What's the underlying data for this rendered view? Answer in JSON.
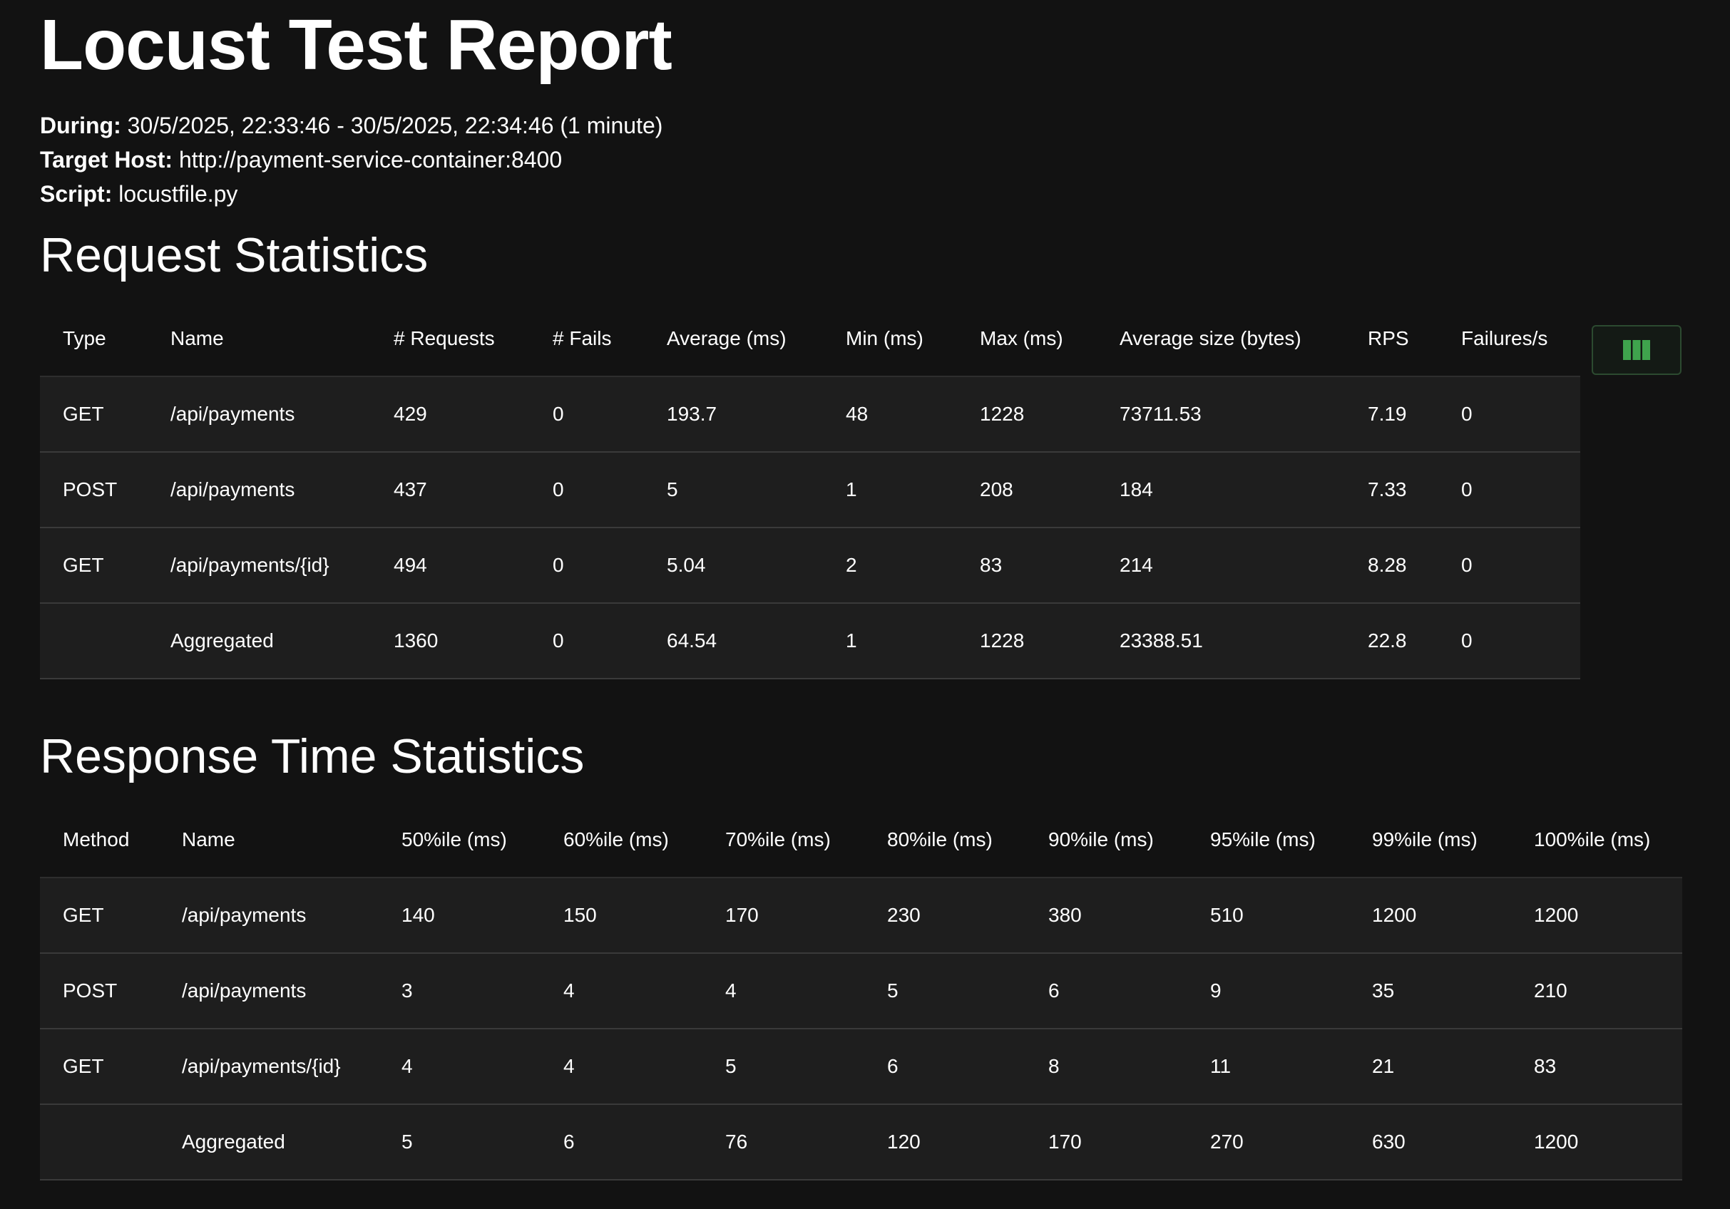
{
  "title": "Locust Test Report",
  "meta": {
    "during_label": "During:",
    "during_value": " 30/5/2025, 22:33:46 - 30/5/2025, 22:34:46 (1 minute)",
    "host_label": "Target Host:",
    "host_value": " http://payment-service-container:8400",
    "script_label": "Script:",
    "script_value": " locustfile.py"
  },
  "request_stats": {
    "heading": "Request Statistics",
    "columns": [
      "Type",
      "Name",
      "# Requests",
      "# Fails",
      "Average (ms)",
      "Min (ms)",
      "Max (ms)",
      "Average size (bytes)",
      "RPS",
      "Failures/s"
    ],
    "rows": [
      [
        "GET",
        "/api/payments",
        "429",
        "0",
        "193.7",
        "48",
        "1228",
        "73711.53",
        "7.19",
        "0"
      ],
      [
        "POST",
        "/api/payments",
        "437",
        "0",
        "5",
        "1",
        "208",
        "184",
        "7.33",
        "0"
      ],
      [
        "GET",
        "/api/payments/{id}",
        "494",
        "0",
        "5.04",
        "2",
        "83",
        "214",
        "8.28",
        "0"
      ],
      [
        "",
        "Aggregated",
        "1360",
        "0",
        "64.54",
        "1",
        "1228",
        "23388.51",
        "22.8",
        "0"
      ]
    ],
    "column_toggle_icon": "columns-icon",
    "accent_color": "#3fa34d"
  },
  "response_stats": {
    "heading": "Response Time Statistics",
    "columns": [
      "Method",
      "Name",
      "50%ile (ms)",
      "60%ile (ms)",
      "70%ile (ms)",
      "80%ile (ms)",
      "90%ile (ms)",
      "95%ile (ms)",
      "99%ile (ms)",
      "100%ile (ms)"
    ],
    "rows": [
      [
        "GET",
        "/api/payments",
        "140",
        "150",
        "170",
        "230",
        "380",
        "510",
        "1200",
        "1200"
      ],
      [
        "POST",
        "/api/payments",
        "3",
        "4",
        "4",
        "5",
        "6",
        "9",
        "35",
        "210"
      ],
      [
        "GET",
        "/api/payments/{id}",
        "4",
        "4",
        "5",
        "6",
        "8",
        "11",
        "21",
        "83"
      ],
      [
        "",
        "Aggregated",
        "5",
        "6",
        "76",
        "120",
        "170",
        "270",
        "630",
        "1200"
      ]
    ]
  }
}
